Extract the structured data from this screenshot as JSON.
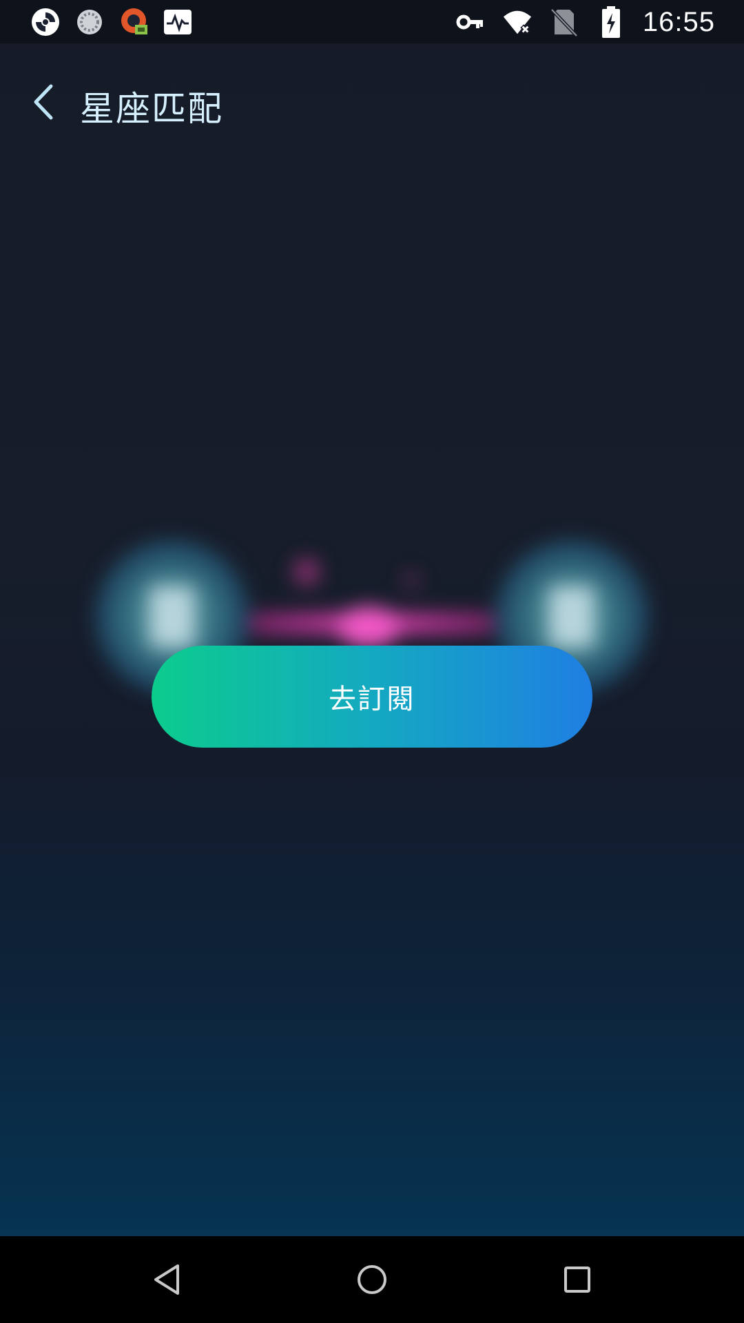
{
  "status_bar": {
    "time": "16:55",
    "left_icons": [
      "app-logo-icon",
      "sync-circle-icon",
      "vpn-app-icon",
      "activity-monitor-icon"
    ],
    "right_icons": [
      "vpn-key-icon",
      "wifi-no-internet-icon",
      "no-sim-icon",
      "battery-charging-icon"
    ]
  },
  "header": {
    "title": "星座匹配",
    "back_icon": "chevron-left-icon"
  },
  "main": {
    "subscribe_label": "去訂閱"
  },
  "nav_bar": {
    "items": [
      "back-triangle-icon",
      "home-circle-icon",
      "recents-square-icon"
    ]
  },
  "colors": {
    "accent_title": "#d6f0ff",
    "button_gradient_start": "#0ccc8d",
    "button_gradient_end": "#1f7fe2",
    "background_top": "#161b27",
    "background_bottom": "#063452"
  }
}
